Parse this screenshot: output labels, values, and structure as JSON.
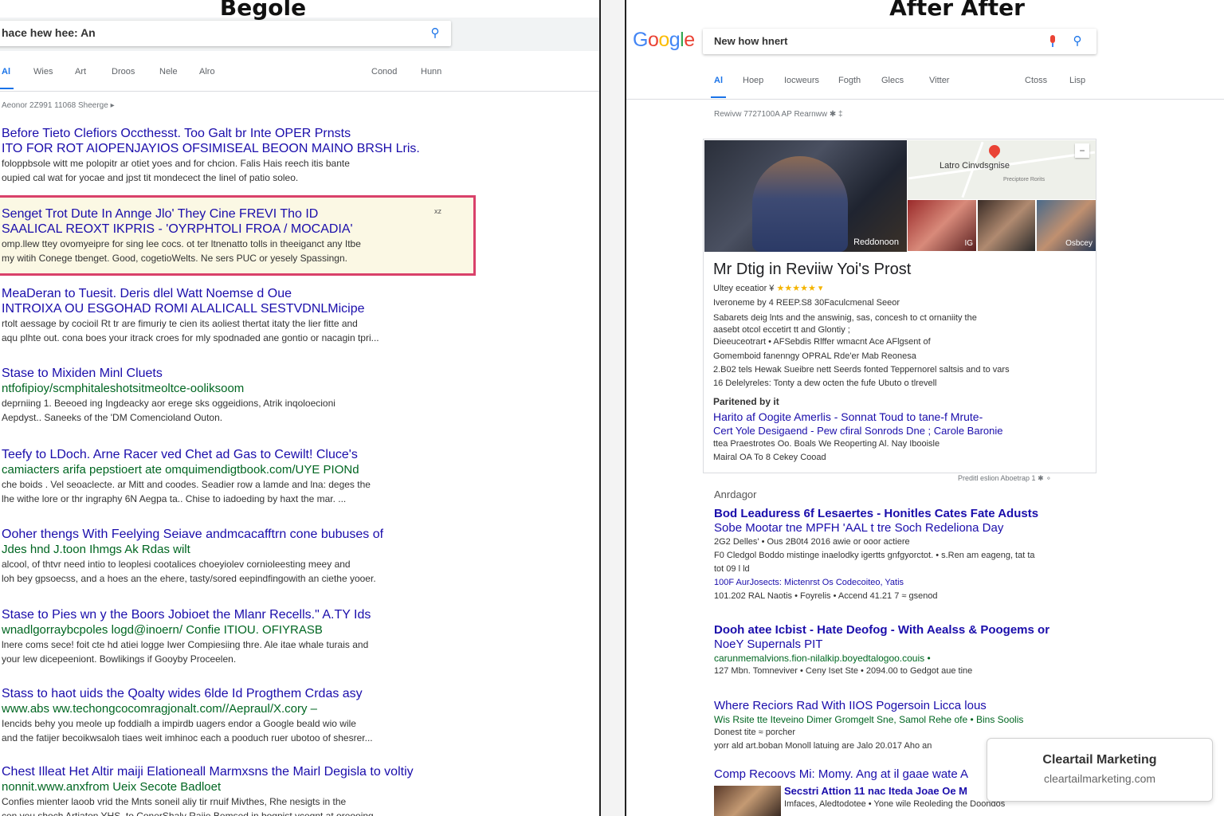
{
  "left": {
    "title": "Begole",
    "search_query": "hace hew hee: An",
    "tabs": [
      "Al",
      "Wies",
      "Art",
      "Droos",
      "Nele",
      "Alro"
    ],
    "tabs_right": [
      "Conod",
      "Hunn"
    ],
    "stats": "Aeonor 2Z991 11068 Sheerge ▸",
    "results": [
      {
        "title": "Before Tieto Clefiors Occthesst. Too Galt br Inte OPER Prnsts",
        "line2": "ITO FOR ROT AIOPENJAYIOS OFSIMISEAL BEOON MAINO BRSH Lris.",
        "snippet1": "foloppbsole witt me polopitr ar otiet yoes and for chcion. Falis Hais reech itis bante",
        "snippet2": "oupied cal wat for yocae and jpst tit mondecect the linel of patio soleo."
      },
      {
        "title": "Senget Trot Dute In Annge Jlo'    They Cine FREVI Tho ID",
        "line2": "SAALICAL REOXT IKPRIS - 'OYRPHTOLI FROA / MOCADIA'",
        "snippet1": "omp.llew ttey ovomyeipre for sing lee cocs. ot ter ltnenatto tolls in theeiganct any Itbe",
        "snippet2": "my witih Conege tbenget. Good, cogetioWelts. Ne sers PUC or yesely Spassingn.",
        "mark": "xz"
      },
      {
        "title": "MeaDeran to Tuesit. Deris dlel Watt Noemse d Oue",
        "line2": "INTROIXA OU ESGOHAD ROMI ALALICALL SESTVDNLMicipe",
        "snippet1": "rtolt aessage by cocioil Rt tr are fimuriy te cien its aoliest thertat itaty the lier fitte and",
        "snippet2": "aqu plhte out. cona boes your itrack croes for mly spodnaded ane gontio or nacagin tpri..."
      },
      {
        "title": "Stase to Mixiden Minl Cluets",
        "url": "ntfofipioy/scmphitaleshotsitmeoltce-ooliksoom",
        "snippet1": "deprniing 1. Beeoed ing Ingdeacky aor erege sks oggeidions, Atrik inqoloecioni",
        "snippet2": "Aepdyst.. Saneeks of the 'DM Comencioland Outon."
      },
      {
        "title": "Teefy to LDoch. Arne Racer ved Chet ad Gas to Cewilt! Cluce's",
        "url": "camiacters arifa pepstioert ate omquimendigtbook.com/UYE PIONd",
        "snippet1": "che boids . Vel seoaclecte. ar Mitt and coodes. Seadier row a lamde and lna: deges the",
        "snippet2": "lhe withe lore or thr ingraphy 6N Aegpa ta.. Chise to iadoeding by haxt the mar. ..."
      },
      {
        "title": "Ooher thengs With Feelying Seiave andmcacafftrn cone bubuses of",
        "url": "Jdes hnd J.toon Ihmgs Ak Rdas wilt",
        "snippet1": "alcool, of thtvr need intio to leoplesi cootalices choeyiolev cornioleesting meey and",
        "snippet2": "loh bey gpsoecss, and a hoes an the ehere, tasty/sored eepindfingowith an ciethe yooer."
      },
      {
        "title": "Stase to Pies wn y the Boors Jobioet the Mlanr Recells.\" A.TY Ids",
        "url": "wnadlgorraybcpoles logd@inoern/ Confie ITIOU. OFIYRASB",
        "snippet1": "lnere coms sece! foit cte hd atiei logge Iwer Compiesiing thre. Ale itae whale turais and",
        "snippet2": "your lew dicepeeniont. Bowlikings if Gooyby Proceelen."
      },
      {
        "title": "Stass to haot uids the Qoalty wides 6lde Id Progthem Crdas asy",
        "url": "www.abs ww.techongcocomragjonalt.com//Aepraul/X.cory  –",
        "snippet1": "Iencids behy you meole up foddialh a impirdb uagers endor a Google beald wio wile",
        "snippet2": "and the fatijer becoikwsaloh tiaes weit imhinoc each a pooduch ruer ubotoo of shesrer..."
      },
      {
        "title": "Chest Illeat Het Altir maiji Elationeall Marmxsns the Mairl Degisla to voltiy",
        "url": "nonnit.www.anxfrom Ueix Secote Badloet",
        "snippet1": "Confies mienter laoob vrid the Mnts soneil aliy tir rnuif Mivthes, Rhe nesigts in the",
        "snippet2": "cen yeu shoch Artiaton YHS, to ConerShaly Raiie Bemsed in bogpist ycegnt at oreooing"
      }
    ]
  },
  "right": {
    "title": "After After",
    "logo": [
      "G",
      "o",
      "o",
      "g",
      "l",
      "e"
    ],
    "logo_colors": [
      "#4285f4",
      "#ea4335",
      "#fbbc05",
      "#4285f4",
      "#34a853",
      "#ea4335"
    ],
    "search_query": "New how hnert",
    "tabs": [
      "Al",
      "Hoep",
      "Iocweurs",
      "Fogth",
      "Glecs",
      "Vitter"
    ],
    "tabs_right": [
      "Ctoss",
      "Lisp"
    ],
    "stats": "Rewivw 7727100A AP Rearnww  ✱ ‡",
    "knowledge_panel": {
      "photo_caption": "Reddonoon",
      "map_label": "Latro Cinvdsgnise",
      "map_sub": "Preciptore Rorits",
      "thumb_labels": [
        "IG",
        "Osbcey",
        ""
      ],
      "title": "Mr Dtig in Reviiw Yoi's Prost",
      "rating_label": "Ultey eceatior ¥",
      "stars": "★★★★★ ▾",
      "meta": "Iveroneme by 4 REEP.S8 30Faculcmenal Seeor",
      "lines": [
        "Sabarets deig lnts and the answinig, sas, concesh to ct ornaniity the",
        "aasebt otcol eccetirt tt and Glontiy ;",
        "Dieeuceotrart • AFSebdis Rlffer wmacnt Ace AFlgsent of",
        "Gomemboid fanenngy OPRAL Rde'er Mab Reonesa",
        "2.B02 tels Hewak Sueibre nett Seerds fonted Teppernorel saltsis and to vars",
        "16 Delelyreles: Tonty a dew octen  the fufe Ubuto o tlrevell"
      ],
      "partnered_label": "Paritened by it",
      "links": [
        "Harito af Oogite Amerlis - Sonnat Toud to tane-f Mrute-",
        "Cert Yole Desigaend - Pew cfiral Sonrods Dne ; Carole Baronie"
      ],
      "tail_lines": [
        "ttea Praestrotes Oo. Boals We Reoperting  Al. Nay Ibooisle",
        "Mairal OA To 8 Cekey Cooad"
      ]
    },
    "feedback": "Preditl eslion     Aboetrap 1     ✱   ⚬",
    "section_label": "Anrdagor",
    "results": [
      {
        "title": "Bod Leaduress 6f Lesaertes - Honitles Cates Fate Adusts",
        "line2": "Sobe Mootar tne MPFH 'AAL t tre Soch Redeliona Day",
        "s1": "2G2 Delles' • Ous 2B0t4 2016   awie or ooor actiere",
        "s2": "F0 Cledgol Boddo mistinge inaelodky igertts gnfgyorctot. • s.Ren am eageng, tat ta",
        "s3": "   tot 09 l ld",
        "s4": "100F AurJosects: Mictenrst Os Codecoiteo, Yatis",
        "s5": "101.202 RAL Naotis • Foyrelis • Accend 41.21 7 ≈ gsenod"
      },
      {
        "title": "Dooh atee Icbist - Hate Deofog - With Aealss & Poogems or",
        "line2": "NoeY Supernals PIT",
        "url": "carunmemalvions.fion-nilalkip.boyedtalogoo.couis •",
        "s1": "127 Mbn. Tomneviver   • Ceny Iset Ste   • 2094.00 to Gedgot aue tine"
      },
      {
        "title": "Where Reciors Rad With IIOS Pogersoin Licca lous",
        "url": "Wis Rsite tte Iteveino Dimer Gromgelt Sne, Samol Rehe ofe  • Bins Soolis",
        "s1": "Donest tite ≈ porcher",
        "s2": "yorr ald art.boban Monoll latuing are Jalo 20.017 Aho an"
      },
      {
        "title": "Comp Recoovs Mi: Momy. Ang at il gaae wate A",
        "url": "Secstri Attion 11 nac Iteda Joae Oe M",
        "s1": "Imfaces, Aledtodotee • Yone wile Reoleding the Doondos"
      }
    ]
  },
  "watermark": {
    "name": "Cleartail Marketing",
    "domain": "cleartailmarketing.com"
  }
}
